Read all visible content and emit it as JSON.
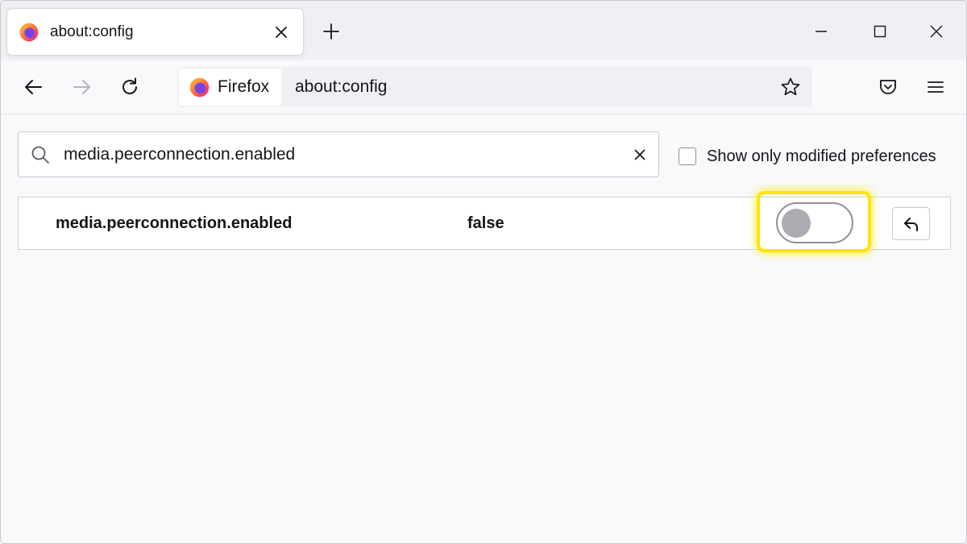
{
  "tab": {
    "title": "about:config",
    "favicon": "firefox-logo"
  },
  "window_controls": {
    "minimize_icon": "minimize-icon",
    "maximize_icon": "maximize-icon",
    "close_icon": "close-icon"
  },
  "toolbar": {
    "back_icon": "back-arrow-icon",
    "forward_icon": "forward-arrow-icon",
    "reload_icon": "reload-icon",
    "pocket_icon": "pocket-icon",
    "menu_icon": "hamburger-menu-icon"
  },
  "urlbar": {
    "identity_label": "Firefox",
    "url": "about:config",
    "bookmark_icon": "star-icon"
  },
  "search": {
    "value": "media.peerconnection.enabled",
    "icon": "search-icon",
    "clear_icon": "clear-icon"
  },
  "filters": {
    "show_modified_label": "Show only modified preferences",
    "show_modified_checked": false
  },
  "preferences": [
    {
      "name": "media.peerconnection.enabled",
      "value": "false",
      "toggle_on": false,
      "toggle_highlighted": true
    }
  ],
  "colors": {
    "highlight": "#ffe500",
    "firefox_orange": "#ff7139",
    "firefox_purple": "#7542e5"
  }
}
